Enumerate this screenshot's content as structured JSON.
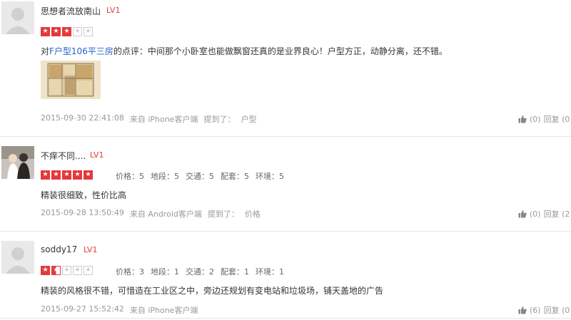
{
  "reviews": [
    {
      "username": "思想者流放南山",
      "level": "LV1",
      "rating": 3,
      "content_prefix": "对",
      "content_link": "F户型106平三房",
      "content_body": "的点评：中间那个小卧室也能做飘窗还真的是业界良心！户型方正，动静分离，还不错。",
      "datetime": "2015-09-30 22:41:08",
      "source": "来自 iPhone客户端",
      "mention_label": "提到了：",
      "mention_value": "户型",
      "likes": "(0)",
      "reply": "回复 (0"
    },
    {
      "username": "不痒不同....",
      "level": "LV1",
      "rating": 5,
      "scores": [
        "价格：5",
        "地段：5",
        "交通：5",
        "配套：5",
        "环境：5"
      ],
      "content": "精装很细致，性价比高",
      "datetime": "2015-09-28 13:50:49",
      "source": "来自 Android客户端",
      "mention_label": "提到了：",
      "mention_value": "价格",
      "likes": "(0)",
      "reply": "回复 (2"
    },
    {
      "username": "soddy17",
      "level": "LV1",
      "rating": 1.5,
      "scores": [
        "价格：3",
        "地段：1",
        "交通：2",
        "配套：1",
        "环境：1"
      ],
      "content": "精装的风格很不错，可惜造在工业区之中，旁边还规划有变电站和垃圾场，铺天盖地的广告",
      "datetime": "2015-09-27 15:52:42",
      "source": "来自 iPhone客户端",
      "likes": "(6)",
      "reply": "回复 (0"
    }
  ],
  "colors": {
    "accent_red": "#e4393c",
    "link_blue": "#2a62c8",
    "meta_gray": "#999999"
  }
}
